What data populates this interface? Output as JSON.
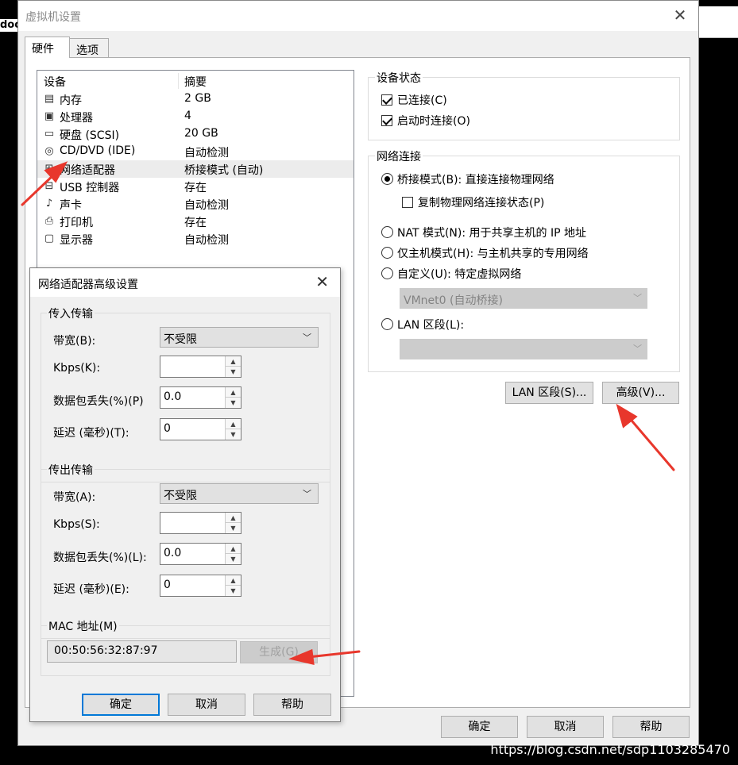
{
  "background": {
    "left_text": "doo"
  },
  "main_window": {
    "title": "虚拟机设置",
    "tabs": [
      "硬件",
      "选项"
    ],
    "device_list": {
      "headers": [
        "设备",
        "摘要"
      ],
      "rows": [
        {
          "icon": "memory-icon",
          "glyph": "▤",
          "name": "内存",
          "summary": "2 GB"
        },
        {
          "icon": "cpu-icon",
          "glyph": "▣",
          "name": "处理器",
          "summary": "4"
        },
        {
          "icon": "harddisk-icon",
          "glyph": "▭",
          "name": "硬盘 (SCSI)",
          "summary": "20 GB"
        },
        {
          "icon": "cd-icon",
          "glyph": "◎",
          "name": "CD/DVD (IDE)",
          "summary": "自动检测"
        },
        {
          "icon": "network-icon",
          "glyph": "⊞",
          "name": "网络适配器",
          "summary": "桥接模式 (自动)"
        },
        {
          "icon": "usb-icon",
          "glyph": "⊟",
          "name": "USB 控制器",
          "summary": "存在"
        },
        {
          "icon": "sound-icon",
          "glyph": "♪",
          "name": "声卡",
          "summary": "自动检测"
        },
        {
          "icon": "printer-icon",
          "glyph": "⎙",
          "name": "打印机",
          "summary": "存在"
        },
        {
          "icon": "display-icon",
          "glyph": "▢",
          "name": "显示器",
          "summary": "自动检测"
        }
      ]
    },
    "device_status": {
      "title": "设备状态",
      "connected": "已连接(C)",
      "connect_on_start": "启动时连接(O)"
    },
    "network": {
      "title": "网络连接",
      "bridged": "桥接模式(B): 直接连接物理网络",
      "replicate": "复制物理网络连接状态(P)",
      "nat": "NAT 模式(N): 用于共享主机的 IP 地址",
      "hostonly": "仅主机模式(H): 与主机共享的专用网络",
      "custom": "自定义(U): 特定虚拟网络",
      "custom_value": "VMnet0 (自动桥接)",
      "lan": "LAN 区段(L):",
      "lan_value": ""
    },
    "buttons": {
      "lan_segments": "LAN 区段(S)...",
      "advanced": "高级(V)...",
      "ok": "确定",
      "cancel": "取消",
      "help": "帮助"
    }
  },
  "advanced_dialog": {
    "title": "网络适配器高级设置",
    "incoming": {
      "title": "传入传输",
      "bandwidth_label": "带宽(B):",
      "bandwidth_value": "不受限",
      "kbps_label": "Kbps(K):",
      "kbps_value": "",
      "loss_label": "数据包丢失(%)(P)",
      "loss_value": "0.0",
      "latency_label": "延迟 (毫秒)(T):",
      "latency_value": "0"
    },
    "outgoing": {
      "title": "传出传输",
      "bandwidth_label": "带宽(A):",
      "bandwidth_value": "不受限",
      "kbps_label": "Kbps(S):",
      "kbps_value": "",
      "loss_label": "数据包丢失(%)(L):",
      "loss_value": "0.0",
      "latency_label": "延迟 (毫秒)(E):",
      "latency_value": "0"
    },
    "mac": {
      "title": "MAC 地址(M)",
      "value": "00:50:56:32:87:97",
      "generate": "生成(G)"
    },
    "buttons": {
      "ok": "确定",
      "cancel": "取消",
      "help": "帮助"
    }
  },
  "watermark": "https://blog.csdn.net/sdp1103285470",
  "colors": {
    "accent": "#0078d7",
    "arrow": "#e8372c"
  }
}
